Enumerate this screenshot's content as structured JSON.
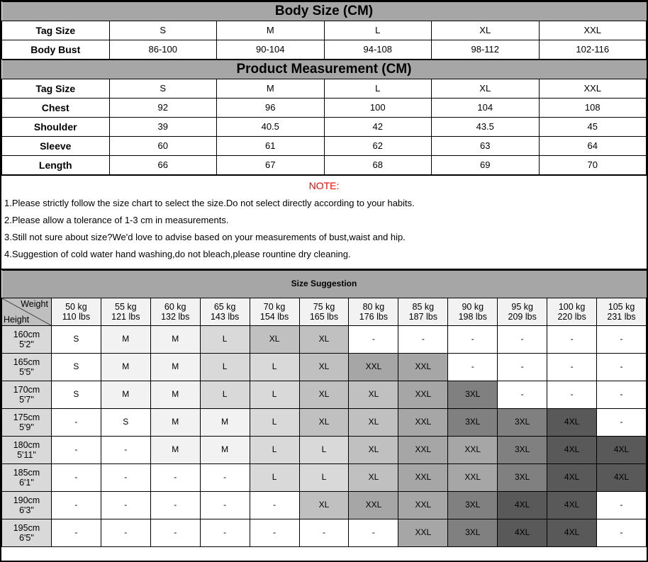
{
  "body_size": {
    "title": "Body Size (CM)",
    "rows": [
      {
        "label": "Tag Size",
        "values": [
          "S",
          "M",
          "L",
          "XL",
          "XXL"
        ]
      },
      {
        "label": "Body Bust",
        "values": [
          "86-100",
          "90-104",
          "94-108",
          "98-112",
          "102-116"
        ]
      }
    ]
  },
  "product_measurement": {
    "title": "Product Measurement (CM)",
    "rows": [
      {
        "label": "Tag Size",
        "values": [
          "S",
          "M",
          "L",
          "XL",
          "XXL"
        ]
      },
      {
        "label": "Chest",
        "values": [
          "92",
          "96",
          "100",
          "104",
          "108"
        ]
      },
      {
        "label": "Shoulder",
        "values": [
          "39",
          "40.5",
          "42",
          "43.5",
          "45"
        ]
      },
      {
        "label": "Sleeve",
        "values": [
          "60",
          "61",
          "62",
          "63",
          "64"
        ]
      },
      {
        "label": "Length",
        "values": [
          "66",
          "67",
          "68",
          "69",
          "70"
        ]
      }
    ]
  },
  "note": {
    "title": "NOTE:",
    "color": "#ff0000",
    "lines": [
      "1.Please strictly follow the size chart to select the size.Do not select directly according to your habits.",
      "2.Please allow a tolerance of 1-3 cm in measurements.",
      "3.Still not sure about size?We'd love to advise based on your measurements of bust,waist and hip.",
      "4.Suggestion of cold water hand washing,do not bleach,please rountine dry cleaning."
    ]
  },
  "size_suggestion": {
    "title": "Size Suggestion",
    "corner": {
      "weight_label": "Weight",
      "height_label": "Height"
    },
    "weight_headers": [
      {
        "kg": "50 kg",
        "lbs": "110 lbs"
      },
      {
        "kg": "55 kg",
        "lbs": "121 lbs"
      },
      {
        "kg": "60 kg",
        "lbs": "132 lbs"
      },
      {
        "kg": "65 kg",
        "lbs": "143 lbs"
      },
      {
        "kg": "70 kg",
        "lbs": "154 lbs"
      },
      {
        "kg": "75 kg",
        "lbs": "165 lbs"
      },
      {
        "kg": "80 kg",
        "lbs": "176 lbs"
      },
      {
        "kg": "85 kg",
        "lbs": "187 lbs"
      },
      {
        "kg": "90 kg",
        "lbs": "198 lbs"
      },
      {
        "kg": "95 kg",
        "lbs": "209 lbs"
      },
      {
        "kg": "100 kg",
        "lbs": "220 lbs"
      },
      {
        "kg": "105 kg",
        "lbs": "231 lbs"
      }
    ],
    "height_rows": [
      {
        "cm": "160cm",
        "ft": "5'2\"",
        "cells": [
          "S",
          "M",
          "M",
          "L",
          "XL",
          "XL",
          "-",
          "-",
          "-",
          "-",
          "-",
          "-"
        ]
      },
      {
        "cm": "165cm",
        "ft": "5'5\"",
        "cells": [
          "S",
          "M",
          "M",
          "L",
          "L",
          "XL",
          "XXL",
          "XXL",
          "-",
          "-",
          "-",
          "-"
        ]
      },
      {
        "cm": "170cm",
        "ft": "5'7\"",
        "cells": [
          "S",
          "M",
          "M",
          "L",
          "L",
          "XL",
          "XL",
          "XXL",
          "3XL",
          "-",
          "-",
          "-"
        ]
      },
      {
        "cm": "175cm",
        "ft": "5'9\"",
        "cells": [
          "-",
          "S",
          "M",
          "M",
          "L",
          "XL",
          "XL",
          "XXL",
          "3XL",
          "3XL",
          "4XL",
          "-"
        ]
      },
      {
        "cm": "180cm",
        "ft": "5'11\"",
        "cells": [
          "-",
          "-",
          "M",
          "M",
          "L",
          "L",
          "XL",
          "XXL",
          "XXL",
          "3XL",
          "4XL",
          "4XL"
        ]
      },
      {
        "cm": "185cm",
        "ft": "6'1\"",
        "cells": [
          "-",
          "-",
          "-",
          "-",
          "L",
          "L",
          "XL",
          "XXL",
          "XXL",
          "3XL",
          "4XL",
          "4XL"
        ]
      },
      {
        "cm": "190cm",
        "ft": "6'3\"",
        "cells": [
          "-",
          "-",
          "-",
          "-",
          "-",
          "XL",
          "XXL",
          "XXL",
          "3XL",
          "4XL",
          "4XL",
          "-"
        ]
      },
      {
        "cm": "195cm",
        "ft": "6'5\"",
        "cells": [
          "-",
          "-",
          "-",
          "-",
          "-",
          "-",
          "-",
          "XXL",
          "3XL",
          "4XL",
          "4XL",
          "-"
        ]
      }
    ],
    "shade_legend": {
      "-": "#ffffff",
      "S": "#ffffff",
      "M": "#f2f2f2",
      "L": "#d9d9d9",
      "XL": "#c0c0c0",
      "XXL": "#a6a6a6",
      "3XL": "#808080",
      "4XL": "#595959"
    }
  }
}
